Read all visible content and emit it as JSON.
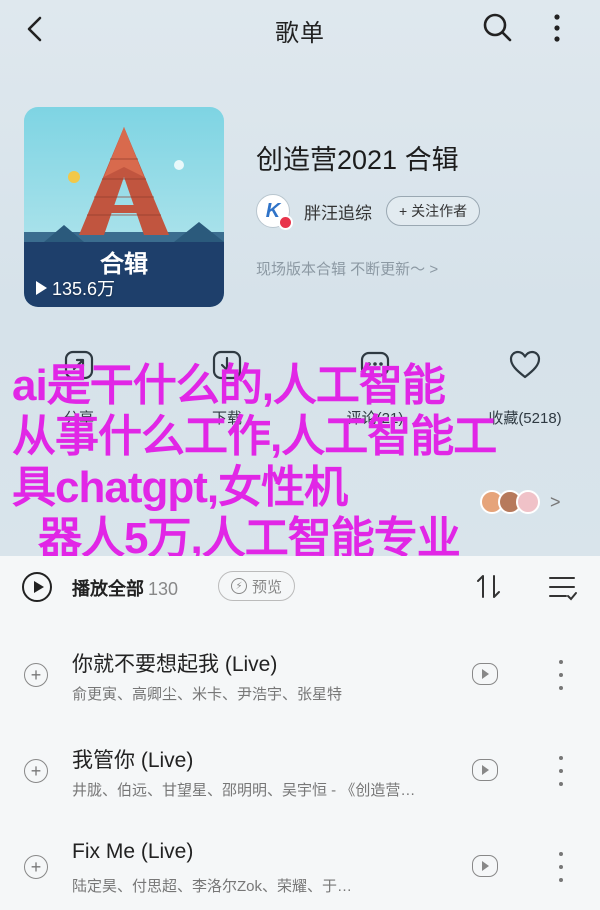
{
  "header": {
    "title": "歌单",
    "back_icon": "chevron-left-icon",
    "search_icon": "search-icon",
    "more_icon": "more-vertical-icon"
  },
  "playlist": {
    "cover_text": "合辑",
    "play_count": "135.6万",
    "title": "创造营2021 合辑",
    "creator": "胖汪追综",
    "follow_label": "+ 关注作者",
    "description": "现场版本合辑 不断更新～ >"
  },
  "actions": [
    {
      "icon": "share-icon",
      "label": "分享"
    },
    {
      "icon": "download-icon",
      "label": "下载"
    },
    {
      "icon": "comment-icon",
      "label": "评论(21)"
    },
    {
      "icon": "heart-icon",
      "label": "收藏(5218)"
    }
  ],
  "overlay": {
    "lines": [
      "ai是干什么的,人工智能",
      "从事什么工作,人工智能工",
      "具chatgpt,女性机",
      "器人5万,人工智能专业"
    ]
  },
  "listeners": {
    "chevron": ">"
  },
  "list_header": {
    "play_all": "播放全部",
    "count": "130",
    "preview_label": "预览"
  },
  "songs": [
    {
      "title": "你就不要想起我 (Live)",
      "artists": "俞更寅、高卿尘、米卡、尹浩宇、张星特"
    },
    {
      "title": "我管你 (Live)",
      "artists": "井胧、伯远、甘望星、邵明明、吴宇恒 - 《创造营…"
    },
    {
      "title": "Fix Me (Live)",
      "artists": "陆定昊、付思超、李洛尔Zok、荣耀、于…"
    }
  ],
  "colors": {
    "overlay_text": "#e126e6",
    "accent_red": "#e8344b",
    "background": "#dde7ee"
  }
}
